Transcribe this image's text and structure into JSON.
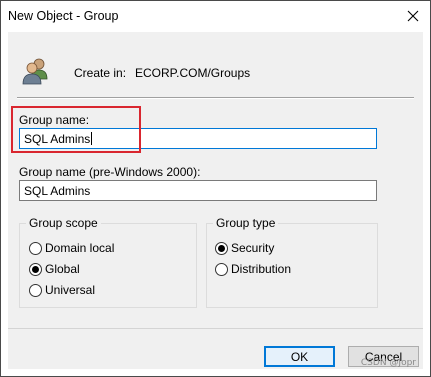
{
  "window": {
    "title": "New Object - Group"
  },
  "header": {
    "icon": "group-users-icon",
    "create_in_label": "Create in:",
    "create_in_path": "ECORP.COM/Groups"
  },
  "group_name": {
    "label": "Group name:",
    "value": "SQL Admins"
  },
  "group_name_pre2000": {
    "label": "Group name (pre-Windows 2000):",
    "value": "SQL Admins"
  },
  "group_scope": {
    "legend": "Group scope",
    "options": [
      {
        "label": "Domain local",
        "selected": false
      },
      {
        "label": "Global",
        "selected": true
      },
      {
        "label": "Universal",
        "selected": false
      }
    ]
  },
  "group_type": {
    "legend": "Group type",
    "options": [
      {
        "label": "Security",
        "selected": true
      },
      {
        "label": "Distribution",
        "selected": false
      }
    ]
  },
  "buttons": {
    "ok": "OK",
    "cancel": "Cancel"
  },
  "watermark": "CSDN @Jopr",
  "colors": {
    "highlight_box": "#d9262f",
    "focus_border": "#0078d7"
  }
}
